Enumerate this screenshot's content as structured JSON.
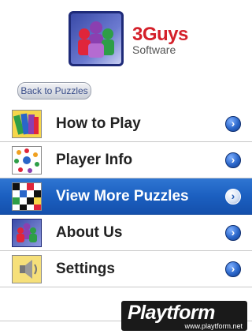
{
  "header": {
    "brand_name": "3Guys",
    "brand_sub": "Software",
    "logo_icon": "three-people-logo-icon"
  },
  "back_button": {
    "label": "Back to Puzzles"
  },
  "menu": {
    "items": [
      {
        "label": "How to Play",
        "icon": "books-icon",
        "selected": false
      },
      {
        "label": "Player Info",
        "icon": "players-circle-icon",
        "selected": false
      },
      {
        "label": "View More Puzzles",
        "icon": "checker-puzzle-icon",
        "selected": true
      },
      {
        "label": "About Us",
        "icon": "three-people-icon",
        "selected": false
      },
      {
        "label": "Settings",
        "icon": "speaker-icon",
        "selected": false
      }
    ]
  },
  "watermark": {
    "main": "Playtform",
    "sub": "www.playtform.net"
  },
  "colors": {
    "accent": "#1b5fc0",
    "brand": "#d4202a",
    "back_button_text": "#3a4e8a"
  }
}
